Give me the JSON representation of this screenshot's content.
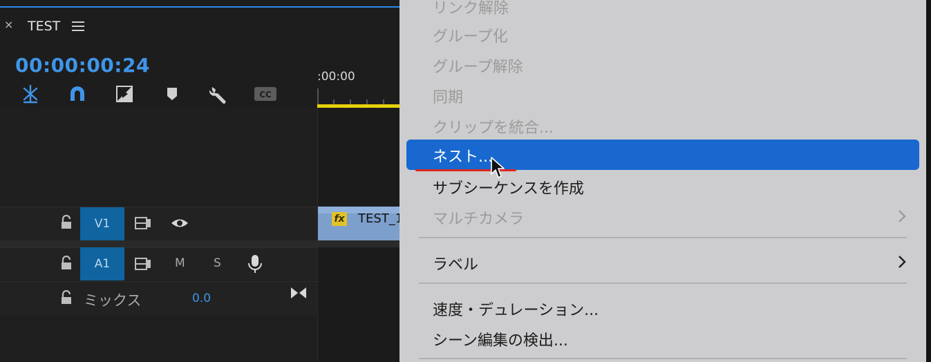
{
  "panel": {
    "close_glyph": "×",
    "title": "TEST",
    "timecode": "00:00:00:24",
    "ruler_label": ":00:00"
  },
  "tools": [
    {
      "icon": "snap-insert-icon",
      "color": "#3f95e8"
    },
    {
      "icon": "magnet-icon",
      "color": "#3f95e8"
    },
    {
      "icon": "linked-selection-icon",
      "color": "#cfcfcf"
    },
    {
      "icon": "add-marker-icon",
      "color": "#cfcfcf"
    },
    {
      "icon": "wrench-icon",
      "color": "#cfcfcf"
    },
    {
      "icon": "captions-icon",
      "color": "#5c5c5c",
      "label": "CC"
    }
  ],
  "tracks": {
    "v1": {
      "label": "V1",
      "icons": [
        "lock-icon",
        "sync-lock-icon",
        "eye-icon"
      ]
    },
    "a1": {
      "label": "A1",
      "mute": "M",
      "solo": "S",
      "icons": [
        "lock-icon",
        "sync-lock-icon",
        "microphone-icon"
      ]
    },
    "mix": {
      "label": "ミックス",
      "value": "0.0"
    }
  },
  "clip": {
    "fx_label": "fx",
    "name": "TEST_1"
  },
  "menu": {
    "items_top": [
      {
        "label": "リンク解除",
        "enabled": false
      },
      {
        "label": "グループ化",
        "enabled": false
      },
      {
        "label": "グループ解除",
        "enabled": false
      },
      {
        "label": "同期",
        "enabled": false
      },
      {
        "label": "クリップを統合...",
        "enabled": false
      }
    ],
    "highlighted": {
      "label": "ネスト..."
    },
    "items_mid": [
      {
        "label": "サブシーケンスを作成",
        "enabled": true
      },
      {
        "label": "マルチカメラ",
        "enabled": false,
        "submenu": true
      }
    ],
    "label_item": {
      "label": "ラベル",
      "submenu": true
    },
    "items_bottom": [
      {
        "label": "速度・デュレーション...",
        "enabled": true
      },
      {
        "label": "シーン編集の検出...",
        "enabled": true
      }
    ]
  },
  "colors": {
    "accent": "#3f95e8",
    "highlight": "#1868cf",
    "track_button": "#1064a0",
    "underline": "#e0281f",
    "work_area": "#e8d10b"
  }
}
